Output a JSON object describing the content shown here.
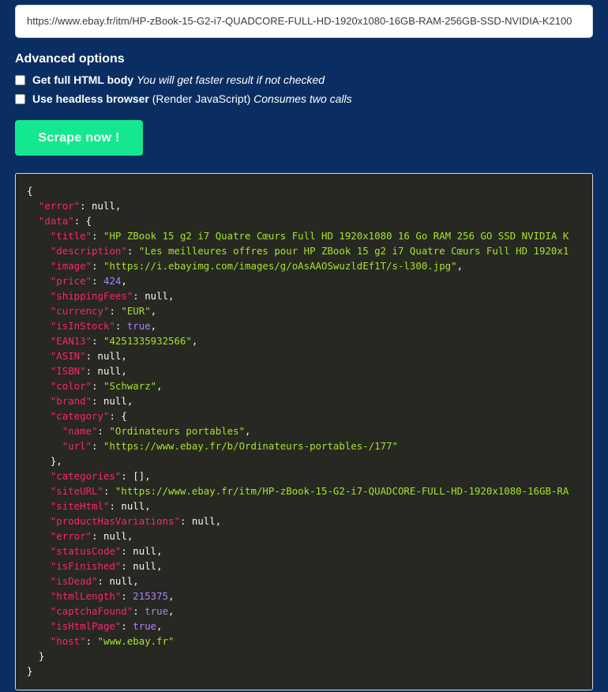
{
  "url_input": {
    "value": "https://www.ebay.fr/itm/HP-zBook-15-G2-i7-QUADCORE-FULL-HD-1920x1080-16GB-RAM-256GB-SSD-NVIDIA-K2100"
  },
  "advanced": {
    "title": "Advanced options",
    "full_html": {
      "label": "Get full HTML body",
      "note": "You will get faster result if not checked"
    },
    "headless": {
      "label": "Use headless browser",
      "sub": "(Render JavaScript)",
      "note": "Consumes two calls"
    }
  },
  "scrape_button": {
    "label": "Scrape now !"
  },
  "result": {
    "lines": [
      [
        [
          "p",
          "{"
        ]
      ],
      [
        [
          "p",
          "  "
        ],
        [
          "k",
          "\"error\""
        ],
        [
          "p",
          ": null,"
        ]
      ],
      [
        [
          "p",
          "  "
        ],
        [
          "k",
          "\"data\""
        ],
        [
          "p",
          ": {"
        ]
      ],
      [
        [
          "p",
          "    "
        ],
        [
          "k",
          "\"title\""
        ],
        [
          "p",
          ": "
        ],
        [
          "s",
          "\"HP ZBook 15 g2 i7 Quatre Cœurs Full HD 1920x1080 16 Go RAM 256 GO SSD NVIDIA K"
        ]
      ],
      [
        [
          "p",
          "    "
        ],
        [
          "k",
          "\"description\""
        ],
        [
          "p",
          ": "
        ],
        [
          "s",
          "\"Les meilleures offres pour HP ZBook 15 g2 i7 Quatre Cœurs Full HD 1920x1"
        ]
      ],
      [
        [
          "p",
          "    "
        ],
        [
          "k",
          "\"image\""
        ],
        [
          "p",
          ": "
        ],
        [
          "s",
          "\"https://i.ebayimg.com/images/g/oAsAAOSwuzldEf1T/s-l300.jpg\""
        ],
        [
          "p",
          ","
        ]
      ],
      [
        [
          "p",
          "    "
        ],
        [
          "k",
          "\"price\""
        ],
        [
          "p",
          ": "
        ],
        [
          "n",
          "424"
        ],
        [
          "p",
          ","
        ]
      ],
      [
        [
          "p",
          "    "
        ],
        [
          "k",
          "\"shippingFees\""
        ],
        [
          "p",
          ": null,"
        ]
      ],
      [
        [
          "p",
          "    "
        ],
        [
          "k",
          "\"currency\""
        ],
        [
          "p",
          ": "
        ],
        [
          "s",
          "\"EUR\""
        ],
        [
          "p",
          ","
        ]
      ],
      [
        [
          "p",
          "    "
        ],
        [
          "k",
          "\"isInStock\""
        ],
        [
          "p",
          ": "
        ],
        [
          "n",
          "true"
        ],
        [
          "p",
          ","
        ]
      ],
      [
        [
          "p",
          "    "
        ],
        [
          "k",
          "\"EAN13\""
        ],
        [
          "p",
          ": "
        ],
        [
          "s",
          "\"4251335932566\""
        ],
        [
          "p",
          ","
        ]
      ],
      [
        [
          "p",
          "    "
        ],
        [
          "k",
          "\"ASIN\""
        ],
        [
          "p",
          ": null,"
        ]
      ],
      [
        [
          "p",
          "    "
        ],
        [
          "k",
          "\"ISBN\""
        ],
        [
          "p",
          ": null,"
        ]
      ],
      [
        [
          "p",
          "    "
        ],
        [
          "k",
          "\"color\""
        ],
        [
          "p",
          ": "
        ],
        [
          "s",
          "\"Schwarz\""
        ],
        [
          "p",
          ","
        ]
      ],
      [
        [
          "p",
          "    "
        ],
        [
          "k",
          "\"brand\""
        ],
        [
          "p",
          ": null,"
        ]
      ],
      [
        [
          "p",
          "    "
        ],
        [
          "k",
          "\"category\""
        ],
        [
          "p",
          ": {"
        ]
      ],
      [
        [
          "p",
          "      "
        ],
        [
          "k",
          "\"name\""
        ],
        [
          "p",
          ": "
        ],
        [
          "s",
          "\"Ordinateurs portables\""
        ],
        [
          "p",
          ","
        ]
      ],
      [
        [
          "p",
          "      "
        ],
        [
          "k",
          "\"url\""
        ],
        [
          "p",
          ": "
        ],
        [
          "s",
          "\"https://www.ebay.fr/b/Ordinateurs-portables-/177\""
        ]
      ],
      [
        [
          "p",
          "    },"
        ]
      ],
      [
        [
          "p",
          "    "
        ],
        [
          "k",
          "\"categories\""
        ],
        [
          "p",
          ": [],"
        ]
      ],
      [
        [
          "p",
          "    "
        ],
        [
          "k",
          "\"siteURL\""
        ],
        [
          "p",
          ": "
        ],
        [
          "s",
          "\"https://www.ebay.fr/itm/HP-zBook-15-G2-i7-QUADCORE-FULL-HD-1920x1080-16GB-RA"
        ]
      ],
      [
        [
          "p",
          "    "
        ],
        [
          "k",
          "\"siteHtml\""
        ],
        [
          "p",
          ": null,"
        ]
      ],
      [
        [
          "p",
          "    "
        ],
        [
          "k",
          "\"productHasVariations\""
        ],
        [
          "p",
          ": null,"
        ]
      ],
      [
        [
          "p",
          "    "
        ],
        [
          "k",
          "\"error\""
        ],
        [
          "p",
          ": null,"
        ]
      ],
      [
        [
          "p",
          "    "
        ],
        [
          "k",
          "\"statusCode\""
        ],
        [
          "p",
          ": null,"
        ]
      ],
      [
        [
          "p",
          "    "
        ],
        [
          "k",
          "\"isFinished\""
        ],
        [
          "p",
          ": null,"
        ]
      ],
      [
        [
          "p",
          "    "
        ],
        [
          "k",
          "\"isDead\""
        ],
        [
          "p",
          ": null,"
        ]
      ],
      [
        [
          "p",
          "    "
        ],
        [
          "k",
          "\"htmlLength\""
        ],
        [
          "p",
          ": "
        ],
        [
          "n",
          "215375"
        ],
        [
          "p",
          ","
        ]
      ],
      [
        [
          "p",
          "    "
        ],
        [
          "k",
          "\"captchaFound\""
        ],
        [
          "p",
          ": "
        ],
        [
          "n",
          "true"
        ],
        [
          "p",
          ","
        ]
      ],
      [
        [
          "p",
          "    "
        ],
        [
          "k",
          "\"isHtmlPage\""
        ],
        [
          "p",
          ": "
        ],
        [
          "n",
          "true"
        ],
        [
          "p",
          ","
        ]
      ],
      [
        [
          "p",
          "    "
        ],
        [
          "k",
          "\"host\""
        ],
        [
          "p",
          ": "
        ],
        [
          "s",
          "\"www.ebay.fr\""
        ]
      ],
      [
        [
          "p",
          "  }"
        ]
      ],
      [
        [
          "p",
          "}"
        ]
      ]
    ]
  }
}
